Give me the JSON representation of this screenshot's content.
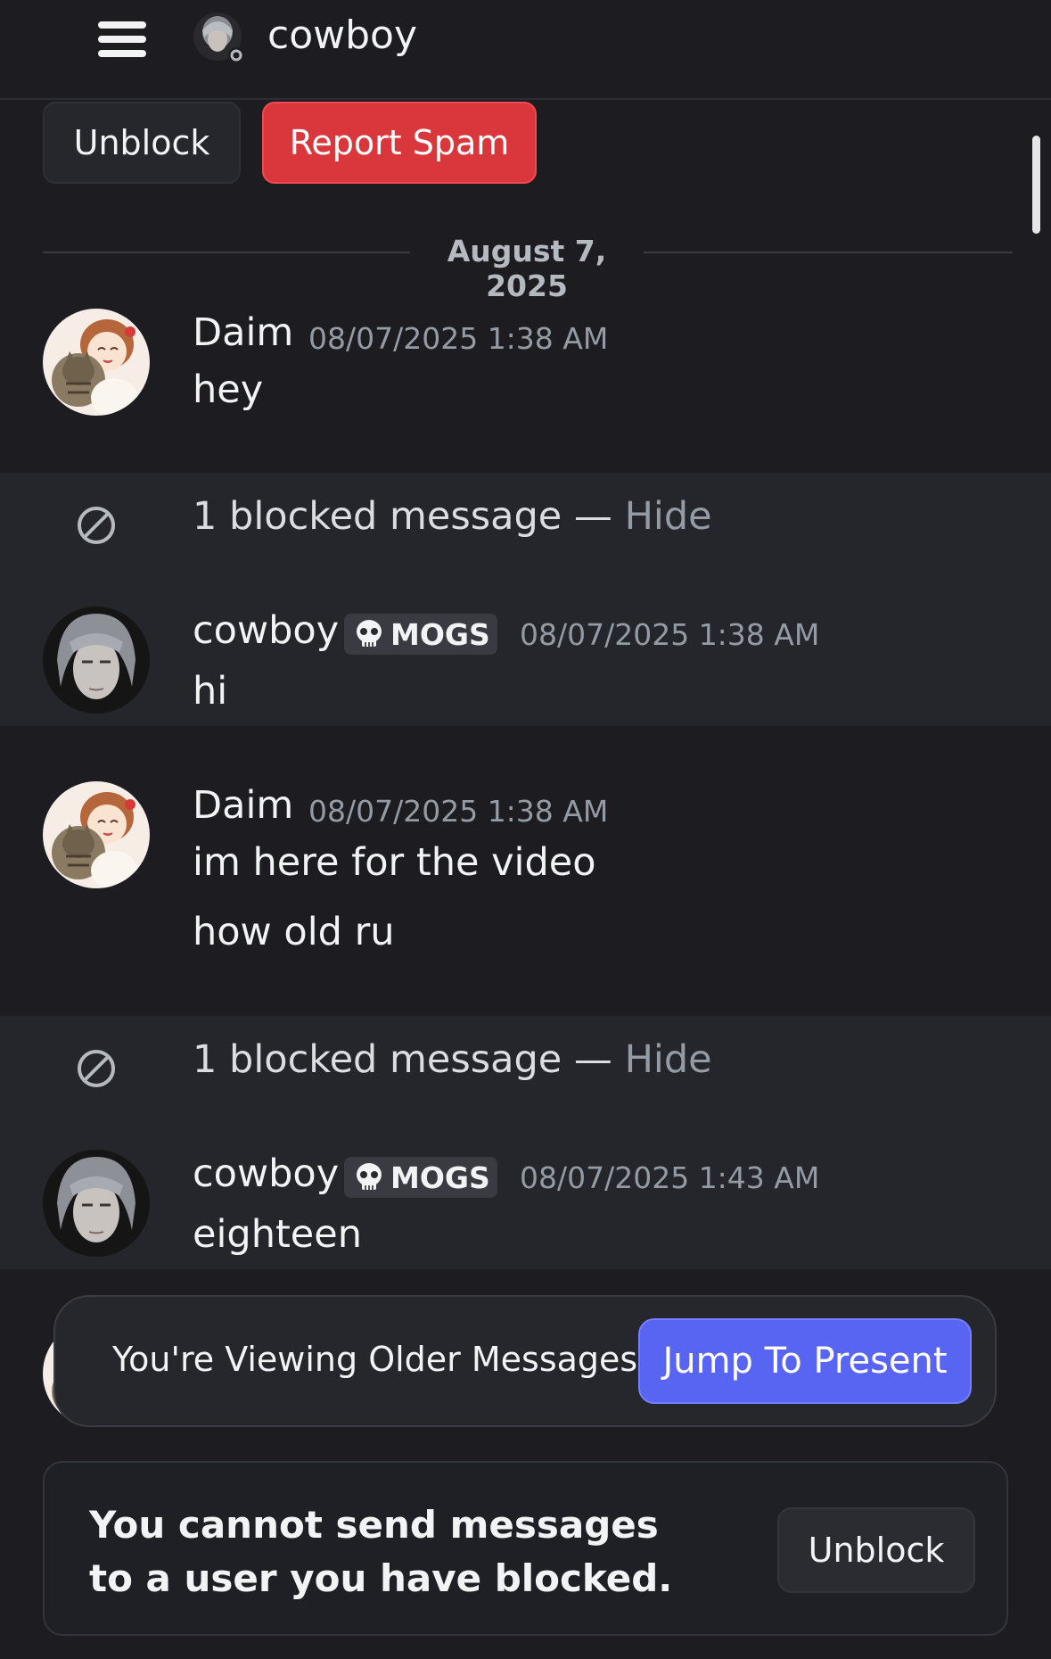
{
  "header": {
    "title": "cowboy",
    "menu_icon": "hamburger-menu-icon",
    "avatar_icon": "user-avatar"
  },
  "actions": {
    "unblock_label": "Unblock",
    "report_label": "Report Spam",
    "report_color": "#da373c"
  },
  "date_divider": "August 7, 2025",
  "messages": [
    {
      "author": "Daim",
      "timestamp": "08/07/2025 1:38 AM",
      "lines": [
        "hey"
      ]
    },
    {
      "author": "cowboy",
      "tag": "MOGS",
      "timestamp": "08/07/2025 1:38 AM",
      "lines": [
        "hi"
      ]
    },
    {
      "author": "Daim",
      "timestamp": "08/07/2025 1:38 AM",
      "lines": [
        "im here for the video",
        "how old ru"
      ]
    },
    {
      "author": "cowboy",
      "tag": "MOGS",
      "timestamp": "08/07/2025 1:43 AM",
      "lines": [
        "eighteen"
      ]
    }
  ],
  "blocked": [
    {
      "text": "1 blocked message — ",
      "hide": "Hide"
    },
    {
      "text": "1 blocked message — ",
      "hide": "Hide"
    }
  ],
  "older_bar": {
    "text": "You're Viewing Older Messages",
    "jump_label": "Jump To Present",
    "accent": "#5865f2"
  },
  "footer": {
    "text": "You cannot send messages to a user you have blocked.",
    "unblock_label": "Unblock"
  }
}
